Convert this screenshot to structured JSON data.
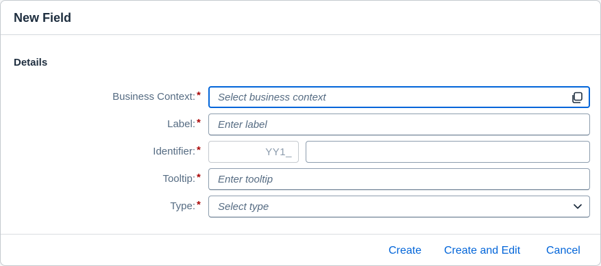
{
  "dialog": {
    "title": "New Field"
  },
  "section": {
    "title": "Details"
  },
  "form": {
    "required_marker": "*",
    "business_context": {
      "label": "Business Context:",
      "placeholder": "Select business context",
      "icon": "value-help-icon"
    },
    "label_field": {
      "label": "Label:",
      "placeholder": "Enter label"
    },
    "identifier": {
      "label": "Identifier:",
      "prefix": "YY1_",
      "value": ""
    },
    "tooltip": {
      "label": "Tooltip:",
      "placeholder": "Enter tooltip"
    },
    "type": {
      "label": "Type:",
      "placeholder": "Select type",
      "icon": "chevron-down-icon"
    }
  },
  "footer": {
    "create": "Create",
    "create_and_edit": "Create and Edit",
    "cancel": "Cancel"
  },
  "colors": {
    "accent": "#0064d9",
    "required": "#aa0808",
    "title_text": "#1d2d3e",
    "label_text": "#556b82"
  }
}
